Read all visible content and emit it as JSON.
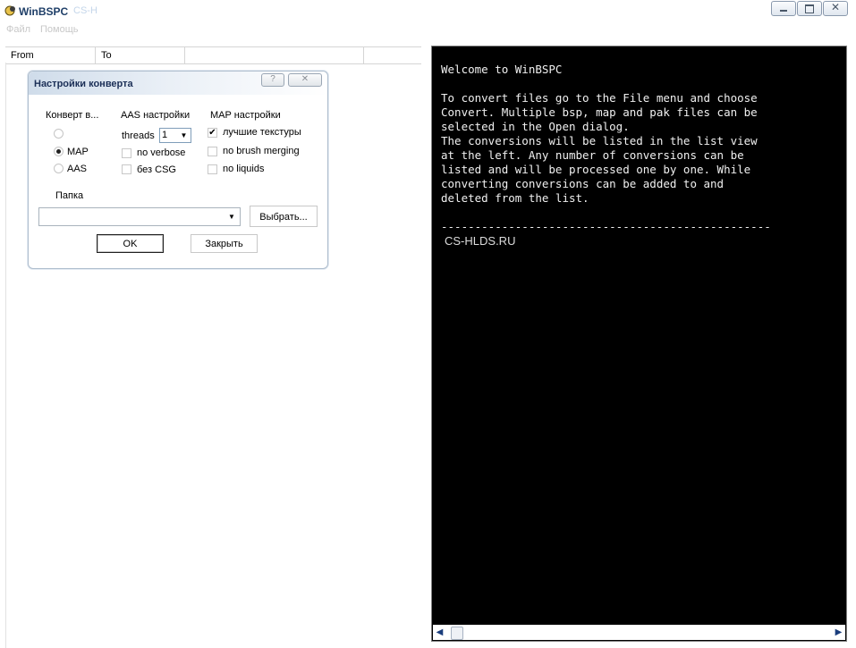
{
  "window": {
    "title": "WinBSPC",
    "title_ghost": "CS-H"
  },
  "menu": [
    {
      "label": "Файл"
    },
    {
      "label": "Помощь"
    }
  ],
  "list": {
    "columns": [
      {
        "label": "From"
      },
      {
        "label": "To"
      },
      {
        "label": ""
      }
    ]
  },
  "dialog": {
    "title": "Настройки конверта",
    "help_label": "?",
    "close_label": "✕",
    "convert_group": {
      "label": "Конверт в...",
      "options": [
        {
          "label": "",
          "selected": false
        },
        {
          "label": "MAP",
          "selected": true
        },
        {
          "label": "AAS",
          "selected": false
        }
      ]
    },
    "aas_group": {
      "label": "AAS настройки",
      "threads_label": "threads",
      "threads_value": "1",
      "options": [
        {
          "label": "no verbose",
          "checked": false
        },
        {
          "label": "без CSG",
          "checked": false
        }
      ]
    },
    "map_group": {
      "label": "MAP настройки",
      "options": [
        {
          "label": "лучшие текстуры",
          "checked": true
        },
        {
          "label": "no brush merging",
          "checked": false
        },
        {
          "label": "no liquids",
          "checked": false
        }
      ]
    },
    "folder_label": "Папка",
    "folder_value": "",
    "browse_label": "Выбрать...",
    "ok_label": "OK",
    "close_button_label": "Закрыть"
  },
  "console": {
    "text": "Welcome to WinBSPC\n\nTo convert files go to the File menu and choose\nConvert. Multiple bsp, map and pak files can be\nselected in the Open dialog.\nThe conversions will be listed in the list view\nat the left. Any number of conversions can be\nlisted and will be processed one by one. While\nconverting conversions can be added to and\ndeleted from the list.\n\n-------------------------------------------------",
    "watermark": "CS-HLDS.RU"
  }
}
